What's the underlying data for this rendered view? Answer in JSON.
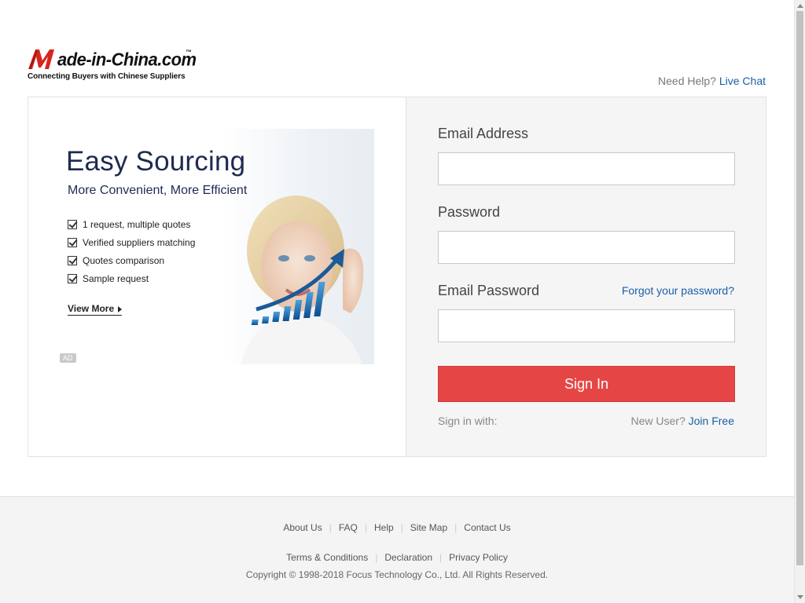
{
  "header": {
    "logo_text": "ade-in-China.com",
    "logo_tm": "™",
    "logo_tagline": "Connecting Buyers with Chinese Suppliers",
    "help_prefix": "Need Help?",
    "help_link": "Live Chat"
  },
  "ad": {
    "title": "Easy Sourcing",
    "subtitle": "More Convenient, More Efficient",
    "bullets": [
      "1 request, multiple quotes",
      "Verified suppliers matching",
      "Quotes comparison",
      "Sample request"
    ],
    "view_more": "View More",
    "ad_tag": "AD"
  },
  "form": {
    "email_label": "Email Address",
    "email_value": "",
    "password_label": "Password",
    "password_value": "",
    "email_password_label": "Email Password",
    "email_password_value": "",
    "forgot_link": "Forgot your password?",
    "signin_button": "Sign In",
    "sign_in_with": "Sign in with:",
    "new_user_prefix": "New User?",
    "join_free": "Join Free"
  },
  "footer": {
    "row1": [
      "About Us",
      "FAQ",
      "Help",
      "Site Map",
      "Contact Us"
    ],
    "row2": [
      "Terms & Conditions",
      "Declaration",
      "Privacy Policy"
    ],
    "copyright": "Copyright © 1998-2018 Focus Technology Co., Ltd. All Rights Reserved."
  },
  "colors": {
    "accent_link": "#1a5ea8",
    "signin_button": "#e64545",
    "brand_red": "#d7261e"
  }
}
